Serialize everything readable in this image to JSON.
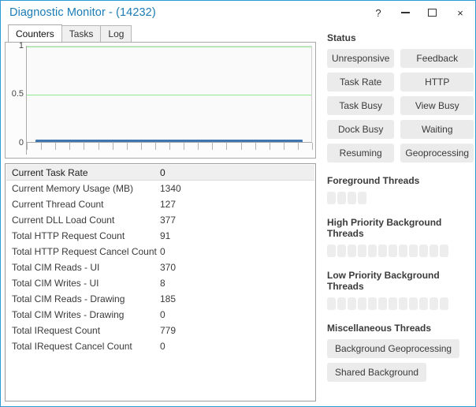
{
  "window": {
    "title": "Diagnostic Monitor - (14232)",
    "accent": "#2e9bd6",
    "title_color": "#1b7cb5",
    "controls": [
      {
        "name": "help-button",
        "glyph": "?"
      },
      {
        "name": "minimize-button",
        "glyph": ""
      },
      {
        "name": "maximize-button",
        "glyph": ""
      },
      {
        "name": "close-button",
        "glyph": "×"
      }
    ]
  },
  "tabs": [
    {
      "label": "Counters",
      "active": true
    },
    {
      "label": "Tasks",
      "active": false
    },
    {
      "label": "Log",
      "active": false
    }
  ],
  "chart_data": {
    "type": "line",
    "title": "",
    "xlabel": "",
    "ylabel": "",
    "ylim": [
      0,
      1
    ],
    "ytick_labels": [
      "0",
      "0.5",
      "1"
    ],
    "ytick_values": [
      0,
      0.5,
      1
    ],
    "gridlines": [
      0,
      0.5,
      1
    ],
    "grid": true,
    "grid_color": "#90e890",
    "series": [
      {
        "name": "Current Task Rate",
        "color": "#3f76b0",
        "values": [
          0,
          0,
          0,
          0,
          0,
          0,
          0,
          0,
          0,
          0,
          0,
          0,
          0,
          0,
          0,
          0,
          0,
          0,
          0,
          0
        ]
      }
    ],
    "x_tick_count": 20,
    "legend": "none"
  },
  "counters": {
    "rows": [
      {
        "name": "Current Task Rate",
        "value": "0"
      },
      {
        "name": "Current Memory Usage (MB)",
        "value": "1340"
      },
      {
        "name": "Current Thread Count",
        "value": "127"
      },
      {
        "name": "Current DLL Load Count",
        "value": "377"
      },
      {
        "name": "Total HTTP Request Count",
        "value": "91"
      },
      {
        "name": "Total HTTP Request Cancel Count",
        "value": "0"
      },
      {
        "name": "Total CIM Reads - UI",
        "value": "370"
      },
      {
        "name": "Total CIM Writes - UI",
        "value": "8"
      },
      {
        "name": "Total CIM Reads - Drawing",
        "value": "185"
      },
      {
        "name": "Total CIM Writes - Drawing",
        "value": "0"
      },
      {
        "name": "Total IRequest Count",
        "value": "779"
      },
      {
        "name": "Total IRequest Cancel Count",
        "value": "0"
      }
    ]
  },
  "status": {
    "title": "Status",
    "buttons": [
      "Unresponsive",
      "Feedback",
      "Task Rate",
      "HTTP",
      "Task Busy",
      "View Busy",
      "Dock Busy",
      "Waiting",
      "Resuming",
      "Geoprocessing"
    ]
  },
  "threads": {
    "foreground": {
      "title": "Foreground Threads",
      "count": 4,
      "active": 0
    },
    "high_priority": {
      "title": "High Priority Background Threads",
      "count": 12,
      "active": 0
    },
    "low_priority": {
      "title": "Low Priority Background Threads",
      "count": 12,
      "active": 0
    }
  },
  "misc": {
    "title": "Miscellaneous Threads",
    "buttons": [
      "Background Geoprocessing",
      "Shared Background"
    ]
  }
}
